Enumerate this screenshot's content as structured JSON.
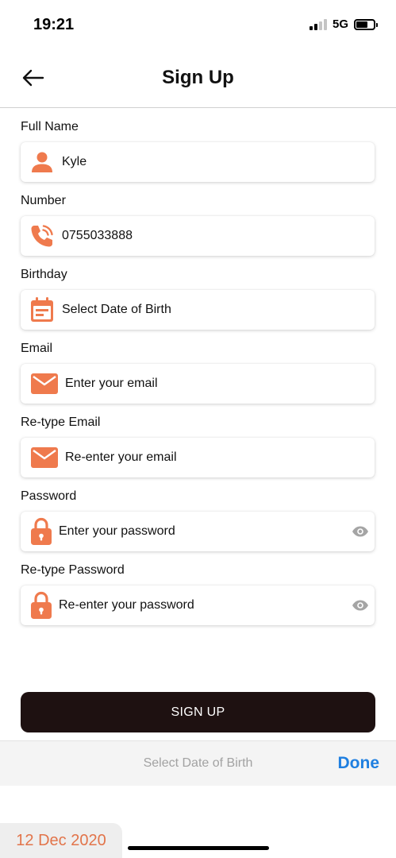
{
  "status_bar": {
    "time": "19:21",
    "network": "5G"
  },
  "header": {
    "title": "Sign Up"
  },
  "form": {
    "full_name": {
      "label": "Full Name",
      "value": "Kyle"
    },
    "number": {
      "label": "Number",
      "value": "0755033888"
    },
    "birthday": {
      "label": "Birthday",
      "placeholder": "Select Date of Birth"
    },
    "email": {
      "label": "Email",
      "placeholder": "Enter your email"
    },
    "retype_email": {
      "label": "Re-type Email",
      "placeholder": "Re-enter your email"
    },
    "password": {
      "label": "Password",
      "placeholder": "Enter your password"
    },
    "retype_password": {
      "label": "Re-type Password",
      "placeholder": "Re-enter your password"
    }
  },
  "signup_button": {
    "label": "SIGN UP"
  },
  "date_picker": {
    "toolbar_title": "Select Date of Birth",
    "done_label": "Done",
    "selected_date": "12 Dec 2020"
  },
  "colors": {
    "accent": "#EF7A4D",
    "button_dark": "#1E1111",
    "done_blue": "#1F7FE0"
  }
}
